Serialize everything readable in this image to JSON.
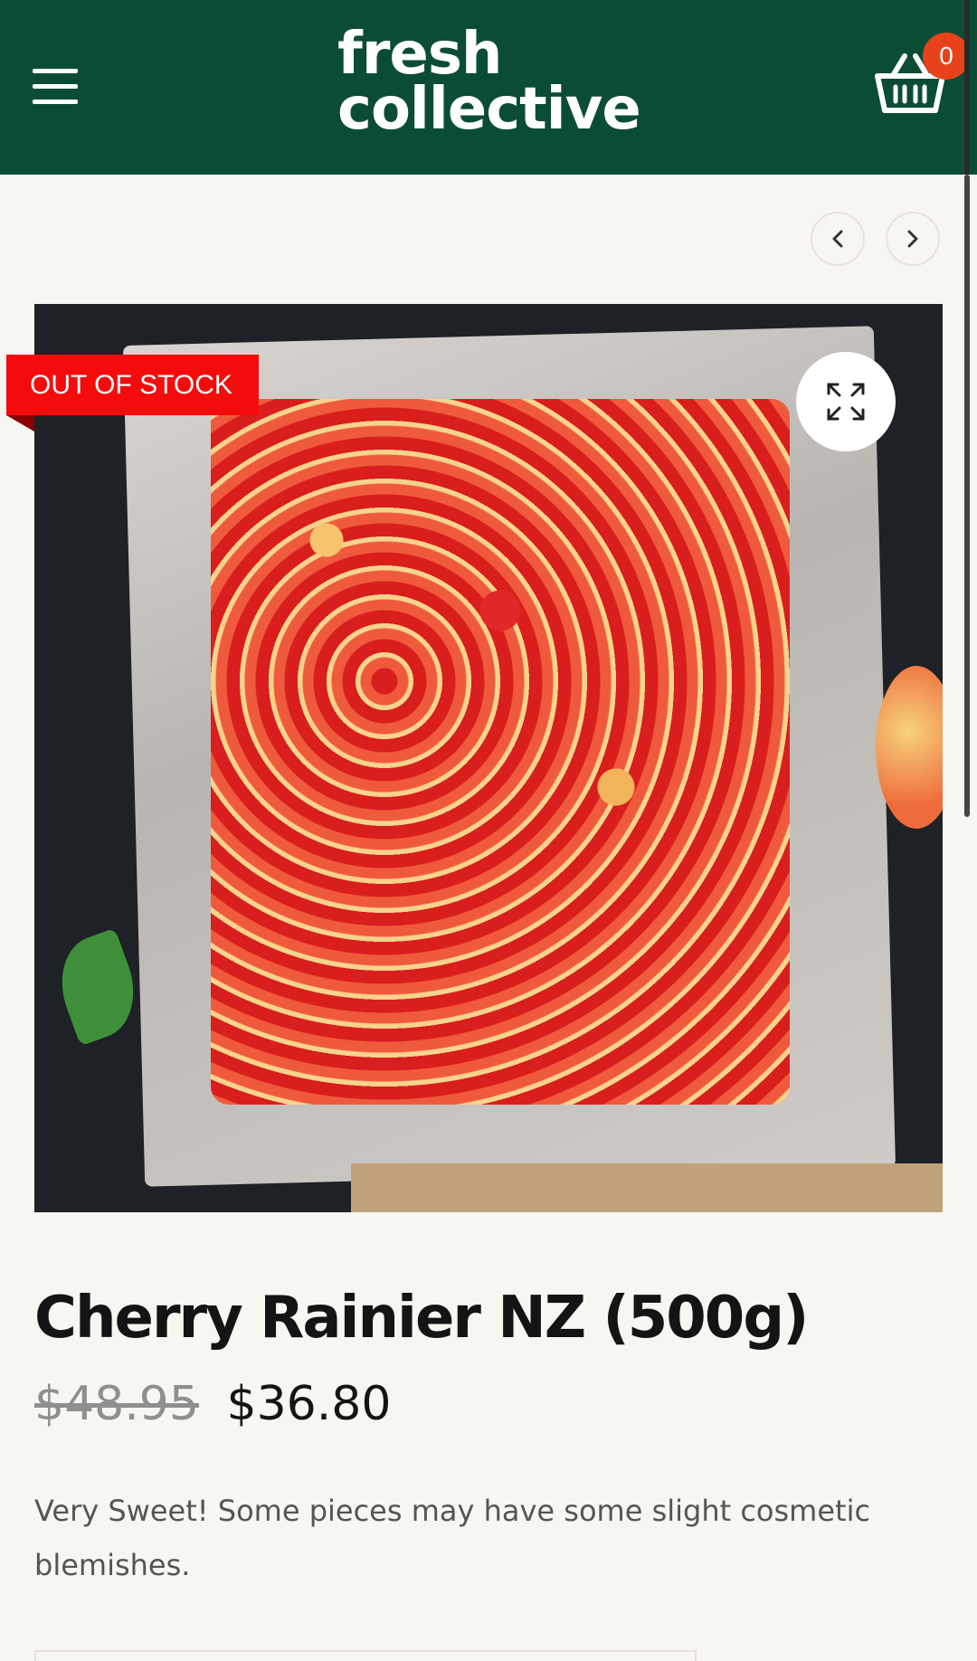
{
  "header": {
    "logo_line1": "fresh",
    "logo_line2": "collective",
    "cart_count": "0",
    "menu_icon": "hamburger-menu-icon",
    "cart_icon": "basket-icon"
  },
  "gallery": {
    "prev_icon": "chevron-left-icon",
    "next_icon": "chevron-right-icon",
    "zoom_icon": "expand-icon",
    "badge": "OUT OF STOCK"
  },
  "product": {
    "title": "Cherry Rainier NZ (500g)",
    "old_price": "$48.95",
    "price": "$36.80",
    "description": "Very Sweet! Some pieces may have some slight cosmetic blemishes."
  },
  "colors": {
    "header_bg": "#0b4d34",
    "badge_bg": "#f40c0c",
    "cart_badge_bg": "#e8421a"
  }
}
